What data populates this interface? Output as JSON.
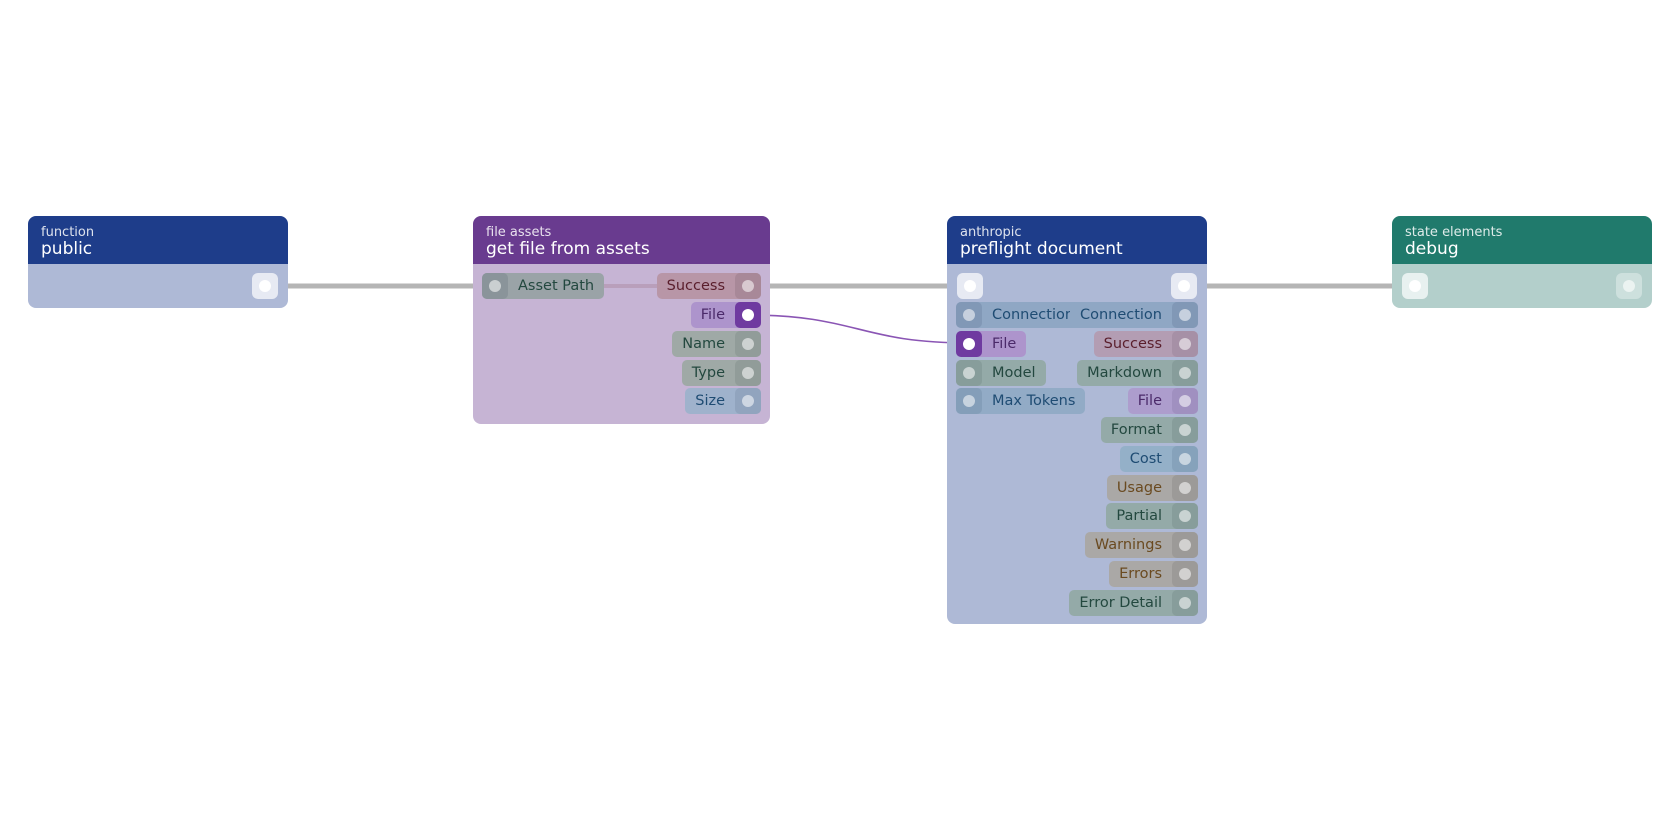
{
  "colors": {
    "blue_header": "#1e3d8a",
    "blue_body": "#aeb9d6",
    "purple_header": "#693b8f",
    "purple_body": "#c6b4d4",
    "teal_header": "#207a6c",
    "teal_body": "#b3cfcb",
    "flow_wire": "#b5b5b5",
    "file_wire": "#8a55b4"
  },
  "nodes": {
    "public": {
      "category": "function",
      "title": "public"
    },
    "get_file": {
      "category": "file assets",
      "title": "get file from assets",
      "inputs": [
        "Asset Path"
      ],
      "outputs": [
        "Success",
        "File",
        "Name",
        "Type",
        "Size"
      ]
    },
    "preflight": {
      "category": "anthropic",
      "title": "preflight document",
      "inputs": [
        "Connection",
        "File",
        "Model",
        "Max Tokens"
      ],
      "outputs": [
        "Connection",
        "Success",
        "Markdown",
        "File",
        "Format",
        "Cost",
        "Usage",
        "Partial",
        "Warnings",
        "Errors",
        "Error Detail"
      ]
    },
    "debug": {
      "category": "state elements",
      "title": "debug"
    }
  }
}
